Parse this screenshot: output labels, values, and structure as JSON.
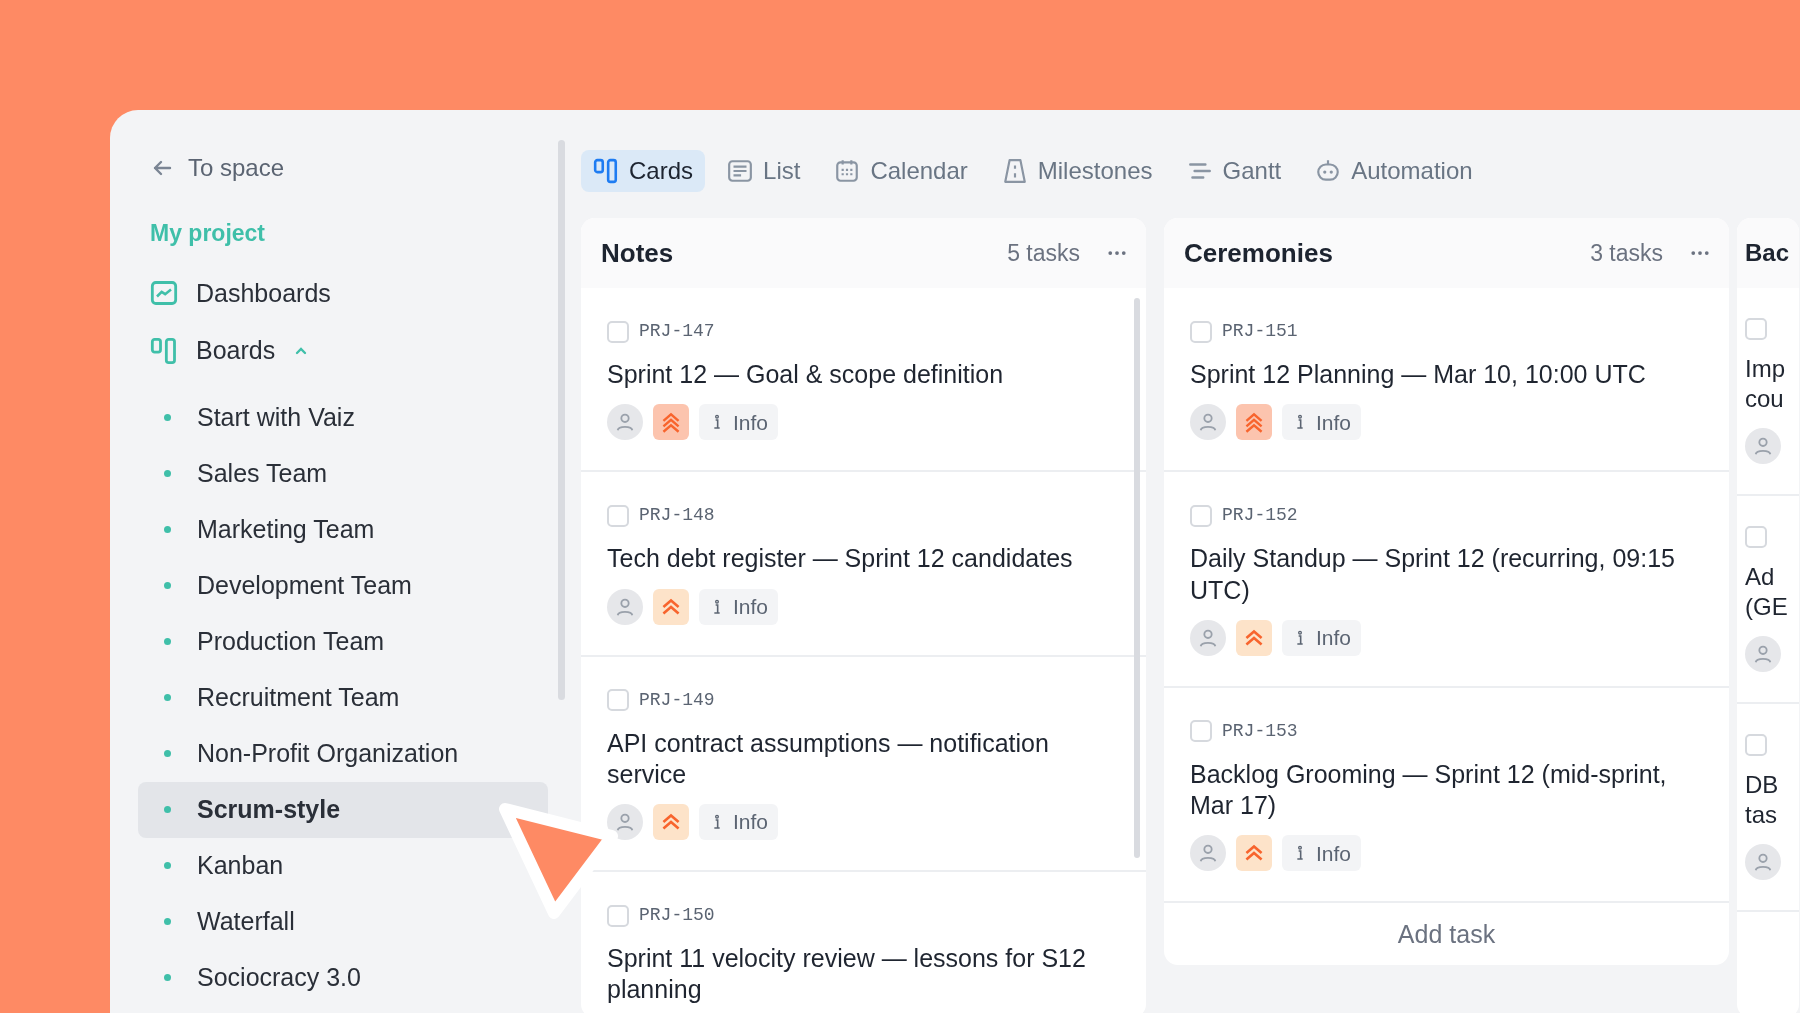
{
  "sidebar": {
    "back_link": "To space",
    "project": "My project",
    "nav": [
      {
        "kind": "dashboards",
        "label": "Dashboards"
      },
      {
        "kind": "boards",
        "label": "Boards",
        "expanded": true
      }
    ],
    "boards": [
      {
        "label": "Start with Vaiz",
        "selected": false
      },
      {
        "label": "Sales Team",
        "selected": false
      },
      {
        "label": "Marketing Team",
        "selected": false
      },
      {
        "label": "Development Team",
        "selected": false
      },
      {
        "label": "Production Team",
        "selected": false
      },
      {
        "label": "Recruitment Team",
        "selected": false
      },
      {
        "label": "Non-Profit Organization",
        "selected": false
      },
      {
        "label": "Scrum-style",
        "selected": true
      },
      {
        "label": "Kanban",
        "selected": false
      },
      {
        "label": "Waterfall",
        "selected": false
      },
      {
        "label": "Sociocracy 3.0",
        "selected": false
      }
    ]
  },
  "view_tabs": [
    {
      "kind": "cards",
      "label": "Cards",
      "selected": true
    },
    {
      "kind": "list",
      "label": "List",
      "selected": false
    },
    {
      "kind": "calendar",
      "label": "Calendar",
      "selected": false
    },
    {
      "kind": "milestones",
      "label": "Milestones",
      "selected": false
    },
    {
      "kind": "gantt",
      "label": "Gantt",
      "selected": false
    },
    {
      "kind": "automation",
      "label": "Automation",
      "selected": false
    }
  ],
  "columns": [
    {
      "title": "Notes",
      "count": "5 tasks",
      "cards": [
        {
          "id": "PRJ-147",
          "checked": false,
          "title": "Sprint 12 — Goal & scope definition",
          "urgent": true,
          "info": "Info"
        },
        {
          "id": "PRJ-148",
          "checked": false,
          "title": "Tech debt register — Sprint 12 candidates",
          "urgent": false,
          "info": "Info"
        },
        {
          "id": "PRJ-149",
          "checked": false,
          "title": "API contract assumptions — notification service",
          "urgent": false,
          "info": "Info"
        },
        {
          "id": "PRJ-150",
          "checked": false,
          "title": "Sprint 11 velocity review — lessons for S12 planning"
        }
      ]
    },
    {
      "title": "Ceremonies",
      "count": "3 tasks",
      "cards": [
        {
          "id": "PRJ-151",
          "checked": false,
          "title": "Sprint 12 Planning — Mar 10, 10:00 UTC",
          "urgent": true,
          "info": "Info"
        },
        {
          "id": "PRJ-152",
          "checked": false,
          "title": "Daily Standup — Sprint 12 (recurring, 09:15 UTC)",
          "urgent": false,
          "info": "Info"
        },
        {
          "id": "PRJ-153",
          "checked": false,
          "title": "Backlog Grooming — Sprint 12 (mid-sprint, Mar 17)",
          "urgent": false,
          "info": "Info"
        }
      ],
      "add_task": "Add task"
    },
    {
      "title": "Bac",
      "cards": [
        {
          "checked": false,
          "title": "Imp\ncou"
        },
        {
          "checked": false,
          "title": "Ad\n(GE"
        },
        {
          "checked": false,
          "title": "DB\ntas"
        }
      ]
    }
  ]
}
